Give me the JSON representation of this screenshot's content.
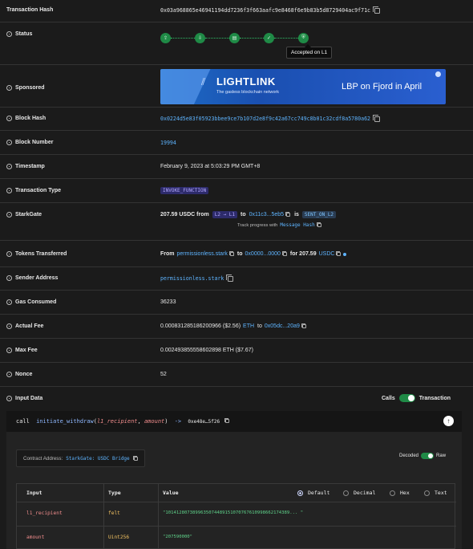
{
  "rows": {
    "tx_hash": {
      "label": "Transaction Hash",
      "value": "0x03a968865e46941194dd7236f3f663aafc9e8468f6e9b83b5d8729404ac9f71c"
    },
    "status": {
      "label": "Status",
      "tooltip": "Accepted on L1",
      "steps": [
        "upload-icon",
        "download-icon",
        "document-icon",
        "check-icon",
        "shield-icon"
      ]
    },
    "sponsored": {
      "label": "Sponsored",
      "banner": {
        "logo": "LIGHTLINK",
        "tagline": "The gasless blockchain network",
        "cta": "LBP on Fjord in April"
      }
    },
    "block_hash": {
      "label": "Block Hash",
      "value": "0x0224d5e83f05923bbee9ce7b107d2e8f9c42a67cc749c8b01c32cdf8a5780a62"
    },
    "block_number": {
      "label": "Block Number",
      "value": "19994"
    },
    "timestamp": {
      "label": "Timestamp",
      "value": "February 9, 2023 at 5:03:29 PM GMT+8"
    },
    "tx_type": {
      "label": "Transaction Type",
      "value": "INVOKE_FUNCTION"
    },
    "starkgate": {
      "label": "StarkGate",
      "amount": "207.59 USDC from",
      "direction": "L2 → L1",
      "to_word": "to",
      "address": "0x11c3...5eb5",
      "is_word": "is",
      "state": "SENT_ON_L2",
      "track_text": "Track progress with",
      "track_link": "Message Hash"
    },
    "tokens": {
      "label": "Tokens Transferred",
      "from_word": "From",
      "from": "permissionless.stark",
      "to_word": "to",
      "to": "0x0000...0000",
      "for_text": "for 207.59",
      "token": "USDC"
    },
    "sender": {
      "label": "Sender Address",
      "value": "permissionless.stark"
    },
    "gas": {
      "label": "Gas Consumed",
      "value": "36233"
    },
    "actual_fee": {
      "label": "Actual Fee",
      "value": "0.000831285186200966 ($2.56)",
      "token": "ETH",
      "to_word": "to",
      "to": "0x05dc...20a9"
    },
    "max_fee": {
      "label": "Max Fee",
      "value": "0.002493855558602898 ETH ($7.67)"
    },
    "nonce": {
      "label": "Nonce",
      "value": "52"
    },
    "input_data": {
      "label": "Input Data",
      "toggle_left": "Calls",
      "toggle_right": "Transaction"
    }
  },
  "call": {
    "prefix": "call",
    "func": "initiate_withdraw",
    "args_open": "(",
    "arg1": "l1_recipient",
    "comma": ", ",
    "arg2": "amount",
    "args_close": ")",
    "arrow": "->",
    "target": "0xe48e…5f26"
  },
  "panel": {
    "contract_label": "Contract Address:",
    "contract_name": "StarkGate: USDC Bridge",
    "decoded": "Decoded",
    "raw": "Raw",
    "headers": {
      "input": "Input",
      "type": "Type",
      "value": "Value"
    },
    "formats": [
      "Default",
      "Decimal",
      "Hex",
      "Text"
    ],
    "rows": [
      {
        "input": "l1_recipient",
        "type": "felt",
        "value": "\"1014128073899635074489151070767610998662174389... \""
      },
      {
        "input": "amount",
        "type": "Uint256",
        "value": "\"207590000\""
      }
    ]
  },
  "colors": {
    "accent_green": "#1f8a46",
    "link_blue": "#5eb4ff",
    "badge_purple": "#2d2b6b"
  }
}
